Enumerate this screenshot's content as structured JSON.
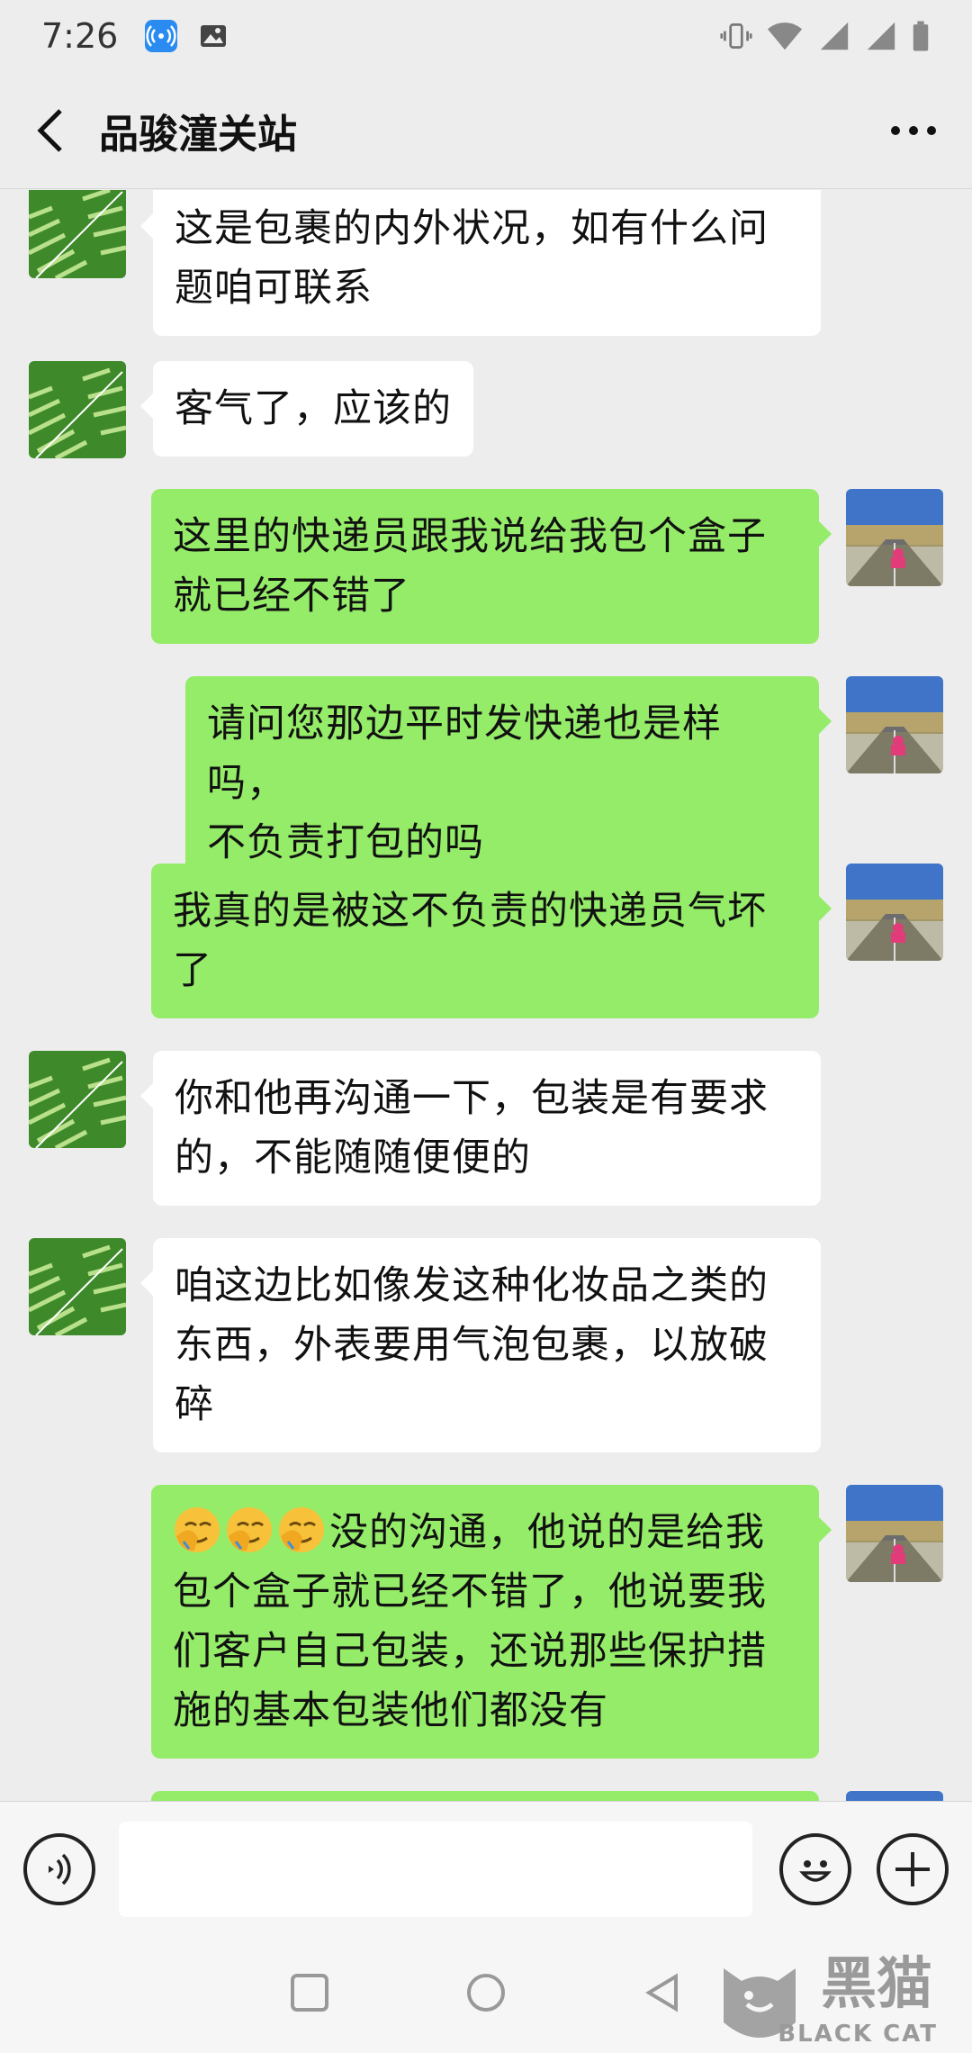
{
  "status_bar": {
    "time": "7:26"
  },
  "header": {
    "title": "品骏潼关站"
  },
  "messages": [
    {
      "side": "left",
      "avatar": "fern-leaf-avatar",
      "text": "这是包裹的内外状况，如有什么问\n题咱可联系"
    },
    {
      "side": "left",
      "avatar": "fern-leaf-avatar",
      "text": "客气了，应该的"
    },
    {
      "side": "right",
      "avatar": "road-photo-avatar",
      "text": "这里的快递员跟我说给我包个盒子\n就已经不错了"
    },
    {
      "side": "right",
      "avatar": "road-photo-avatar",
      "text": "请问您那边平时发快递也是样吗，\n不负责打包的吗"
    },
    {
      "side": "right",
      "avatar": "road-photo-avatar",
      "text": "我真的是被这不负责的快递员气坏\n了"
    },
    {
      "side": "left",
      "avatar": "fern-leaf-avatar",
      "text": "你和他再沟通一下，包装是有要求\n的，不能随随便便的"
    },
    {
      "side": "left",
      "avatar": "fern-leaf-avatar",
      "text": "咱这边比如像发这种化妆品之类的\n东西，外表要用气泡包裹，以放破\n碎"
    },
    {
      "side": "right",
      "avatar": "road-photo-avatar",
      "emoji": [
        "facepalm-emoji",
        "facepalm-emoji",
        "facepalm-emoji"
      ],
      "text": "没的沟通，他说的是给我\n包个盒子就已经不错了，他说要我\n们客户自己包装，还说那些保护措\n施的基本包装他们都没有"
    }
  ],
  "input_bar": {
    "placeholder": ""
  },
  "watermark": {
    "cjk": "黑猫",
    "latin": "BLACK CAT"
  },
  "colors": {
    "background": "#ededed",
    "sent_bubble": "#95ec69",
    "received_bubble": "#ffffff"
  }
}
